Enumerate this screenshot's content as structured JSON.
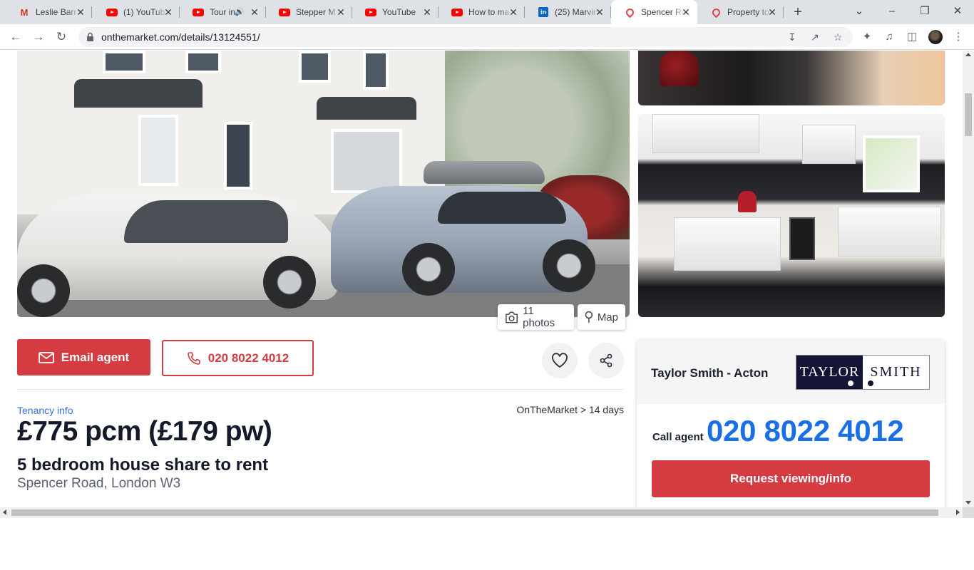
{
  "browser": {
    "tabs": [
      {
        "title": "Leslie Barr",
        "icon": "gmail-icon",
        "active": false
      },
      {
        "title": "(1) YouTub",
        "icon": "youtube-icon",
        "active": false
      },
      {
        "title": "Tour in",
        "icon": "youtube-icon",
        "active": false,
        "audio": true
      },
      {
        "title": "Stepper M",
        "icon": "youtube-icon",
        "active": false
      },
      {
        "title": "YouTube",
        "icon": "youtube-icon",
        "active": false
      },
      {
        "title": "How to ma",
        "icon": "youtube-icon",
        "active": false
      },
      {
        "title": "(25) Marvin",
        "icon": "linkedin-icon",
        "active": false
      },
      {
        "title": "Spencer Ro",
        "icon": "onthemarket-pin-icon",
        "active": true
      },
      {
        "title": "Property to",
        "icon": "onthemarket-pin-icon",
        "active": false
      }
    ],
    "new_tab": "+",
    "url": "onthemarket.com/details/13124551/",
    "linkedin_glyph": "in",
    "gmail_glyph": "M"
  },
  "gallery": {
    "photo_count_label": "11 photos",
    "map_label": "Map"
  },
  "actions": {
    "email_label": "Email agent",
    "phone_label": "020 8022 4012"
  },
  "listing": {
    "tenancy_link": "Tenancy info",
    "listed_text": "OnTheMarket > 14 days",
    "price": "£775 pcm (£179 pw)",
    "title": "5 bedroom house share to rent",
    "address": "Spencer Road, London W3"
  },
  "agent": {
    "name": "Taylor Smith - Acton",
    "logo_left": "TAYLOR",
    "logo_right": "SMITH",
    "call_label": "Call agent",
    "phone": "020 8022 4012",
    "request_label": "Request viewing/info"
  },
  "colors": {
    "accent_red": "#d43c42",
    "phone_blue": "#1a6fe6",
    "link_blue": "#3a6fd8",
    "logo_navy": "#141437"
  }
}
